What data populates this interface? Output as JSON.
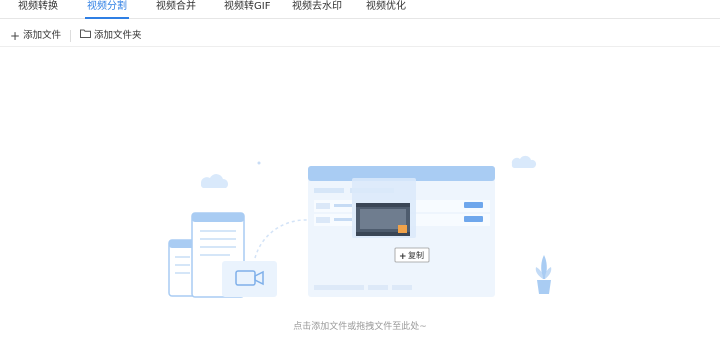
{
  "tabs": [
    {
      "label": "视频转换",
      "active": false
    },
    {
      "label": "视频分割",
      "active": true
    },
    {
      "label": "视频合并",
      "active": false
    },
    {
      "label": "视频转GIF",
      "active": false
    },
    {
      "label": "视频去水印",
      "active": false
    },
    {
      "label": "视频优化",
      "active": false
    }
  ],
  "toolbar": {
    "add_file_label": "添加文件",
    "add_folder_label": "添加文件夹"
  },
  "illustration": {
    "copy_label": "复制"
  },
  "dropzone": {
    "hint": "点击添加文件或拖拽文件至此处~"
  },
  "colors": {
    "accent": "#2f7fe4",
    "illustration_blue": "#a9ccf3",
    "illustration_light": "#e8f1fc"
  },
  "icons": [
    "plus-icon",
    "folder-icon",
    "cloud-icon",
    "video-camera-icon",
    "plant-icon",
    "film-icon",
    "cursor-icon"
  ]
}
